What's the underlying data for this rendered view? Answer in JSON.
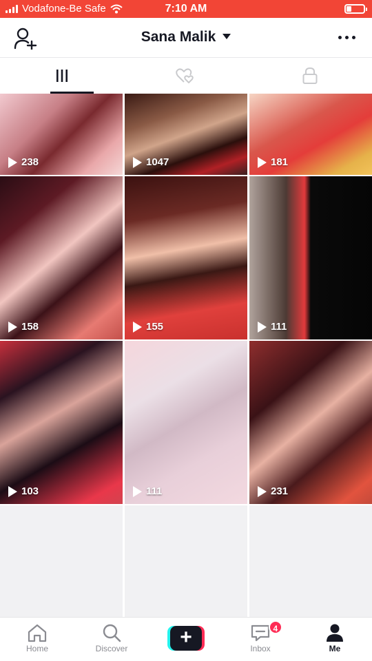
{
  "status_bar": {
    "carrier": "Vodafone-Be Safe",
    "time": "7:10 AM",
    "battery_level": 0.3,
    "background_color": "#f24536"
  },
  "header": {
    "title": "Sana Malik",
    "left_icon": "add-user-icon",
    "right_icon": "more-dots-icon"
  },
  "tabs": [
    {
      "icon": "grid-bars-icon",
      "active": true
    },
    {
      "icon": "liked-hearts-icon",
      "active": false
    },
    {
      "icon": "lock-icon",
      "active": false
    }
  ],
  "videos": [
    {
      "views": "238"
    },
    {
      "views": "1047"
    },
    {
      "views": "181"
    },
    {
      "views": "158"
    },
    {
      "views": "155"
    },
    {
      "views": "111"
    },
    {
      "views": "103"
    },
    {
      "views": "111"
    },
    {
      "views": "231"
    }
  ],
  "bottom_nav": {
    "home": "Home",
    "discover": "Discover",
    "inbox": "Inbox",
    "inbox_badge": "4",
    "me": "Me"
  },
  "colors": {
    "accent_red": "#fe2c55",
    "accent_cyan": "#25f4ee",
    "text_dark": "#161823"
  }
}
